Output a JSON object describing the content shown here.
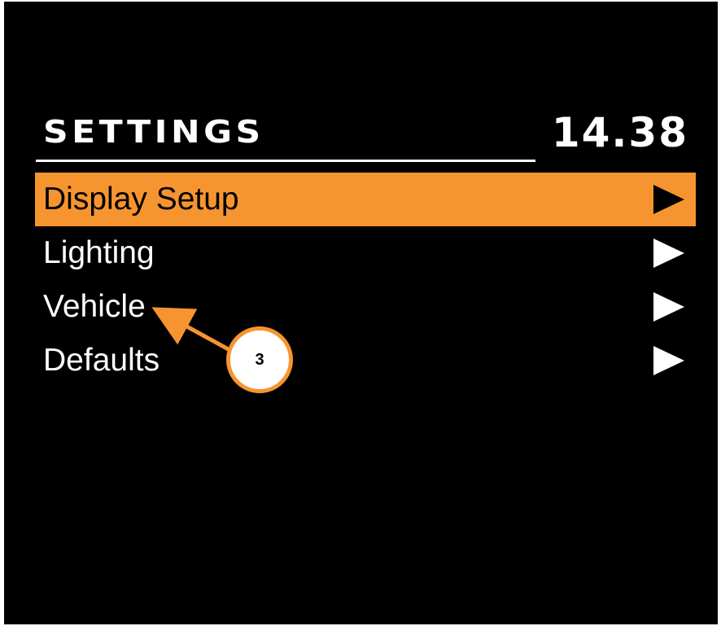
{
  "header": {
    "title": "SETTINGS",
    "clock": "14.38"
  },
  "menu": {
    "items": [
      {
        "label": "Display Setup",
        "selected": true
      },
      {
        "label": "Lighting",
        "selected": false
      },
      {
        "label": "Vehicle",
        "selected": false
      },
      {
        "label": "Defaults",
        "selected": false
      }
    ]
  },
  "callout": {
    "number": "3",
    "target": "Vehicle"
  },
  "colors": {
    "accent": "#f6952f",
    "background": "#000000",
    "text": "#ffffff"
  },
  "icons": {
    "menu_arrow": "play-right-icon"
  }
}
